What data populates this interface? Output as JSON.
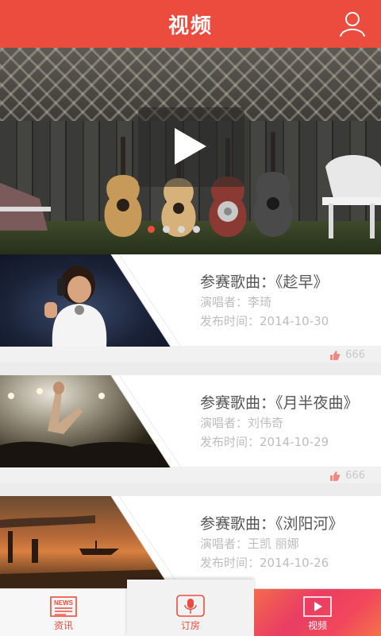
{
  "header": {
    "title": "视频",
    "user_icon": "user-icon"
  },
  "banner": {
    "play_icon": "play-icon",
    "page_count": 4,
    "active_page": 1
  },
  "cards": [
    {
      "song": "参赛歌曲：《趁早》",
      "performer_label": "演唱者：",
      "performer": "李琦",
      "date_label": "发布时间：",
      "date": "2014-10-30",
      "likes": "666"
    },
    {
      "song": "参赛歌曲：《月半夜曲》",
      "performer_label": "演唱者：",
      "performer": "刘伟奇",
      "date_label": "发布时间：",
      "date": "2014-10-29",
      "likes": "666"
    },
    {
      "song": "参赛歌曲：《浏阳河》",
      "performer_label": "演唱者：",
      "performer": "王凯  丽娜",
      "date_label": "发布时间：",
      "date": "2014-10-26"
    }
  ],
  "tabs": {
    "news": {
      "label": "资讯",
      "icon_text": "NEWS"
    },
    "order": {
      "label": "订房"
    },
    "video": {
      "label": "视频"
    }
  },
  "colors": {
    "accent": "#ec4c3d",
    "muted": "#bdbdbd"
  }
}
